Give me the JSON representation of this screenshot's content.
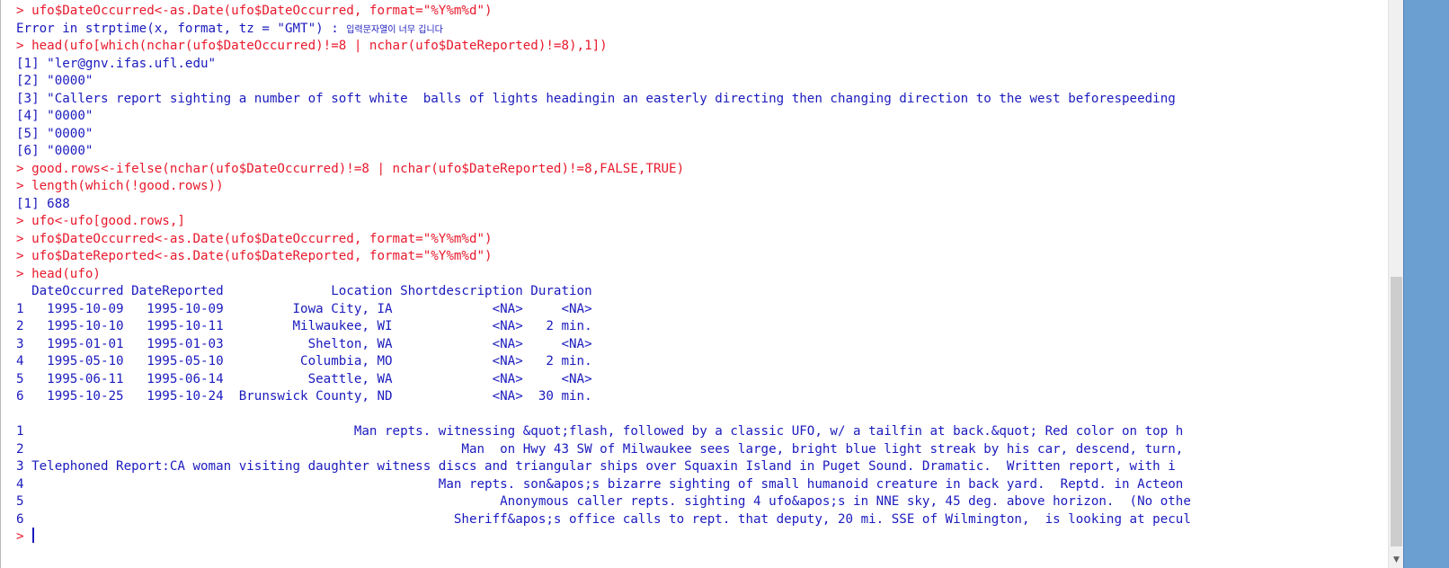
{
  "console": {
    "lines": [
      {
        "type": "cmd",
        "text": "> ufo$DateOccurred<-as.Date(ufo$DateOccurred, format=\"%Y%m%d\")"
      },
      {
        "type": "out",
        "text": "Error in strptime(x, format, tz = \"GMT\") : ",
        "kr": "입력문자열이 너무 깁니다"
      },
      {
        "type": "cmd",
        "text": "> head(ufo[which(nchar(ufo$DateOccurred)!=8 | nchar(ufo$DateReported)!=8),1])"
      },
      {
        "type": "out",
        "text": "[1] \"ler@gnv.ifas.ufl.edu\"",
        "end": "$"
      },
      {
        "type": "out",
        "text": "[2] \"0000\"",
        "end": "$"
      },
      {
        "type": "out",
        "text": "[3] \"Callers report sighting a number of soft white  balls of lights headingin an easterly directing then changing direction to the west beforespeeding",
        "end": "$"
      },
      {
        "type": "out",
        "text": "[4] \"0000\"",
        "end": "$"
      },
      {
        "type": "out",
        "text": "[5] \"0000\"",
        "end": "$"
      },
      {
        "type": "out",
        "text": "[6] \"0000\"",
        "end": "$"
      },
      {
        "type": "cmd",
        "text": "> good.rows<-ifelse(nchar(ufo$DateOccurred)!=8 | nchar(ufo$DateReported)!=8,FALSE,TRUE)"
      },
      {
        "type": "cmd",
        "text": "> length(which(!good.rows))"
      },
      {
        "type": "out",
        "text": "[1] 688"
      },
      {
        "type": "cmd",
        "text": "> ufo<-ufo[good.rows,]"
      },
      {
        "type": "cmd",
        "text": "> ufo$DateOccurred<-as.Date(ufo$DateOccurred, format=\"%Y%m%d\")"
      },
      {
        "type": "cmd",
        "text": "> ufo$DateReported<-as.Date(ufo$DateReported, format=\"%Y%m%d\")"
      },
      {
        "type": "cmd",
        "text": "> head(ufo)"
      },
      {
        "type": "out",
        "text": "  DateOccurred DateReported              Location Shortdescription Duration"
      },
      {
        "type": "out",
        "text": "1   1995-10-09   1995-10-09         Iowa City, IA             <NA>     <NA>"
      },
      {
        "type": "out",
        "text": "2   1995-10-10   1995-10-11         Milwaukee, WI             <NA>   2 min."
      },
      {
        "type": "out",
        "text": "3   1995-01-01   1995-01-03           Shelton, WA             <NA>     <NA>"
      },
      {
        "type": "out",
        "text": "4   1995-05-10   1995-05-10          Columbia, MO             <NA>   2 min."
      },
      {
        "type": "out",
        "text": "5   1995-06-11   1995-06-14           Seattle, WA             <NA>     <NA>"
      },
      {
        "type": "out",
        "text": "6   1995-10-25   1995-10-24  Brunswick County, ND             <NA>  30 min."
      },
      {
        "type": "out",
        "text": "",
        "end": "$"
      },
      {
        "type": "out",
        "text": "1                                           Man repts. witnessing &quot;flash, followed by a classic UFO, w/ a tailfin at back.&quot; Red color on top h",
        "end": "$"
      },
      {
        "type": "out",
        "text": "2                                                         Man  on Hwy 43 SW of Milwaukee sees large, bright blue light streak by his car, descend, turn, ",
        "end": "$"
      },
      {
        "type": "out",
        "text": "3 Telephoned Report:CA woman visiting daughter witness discs and triangular ships over Squaxin Island in Puget Sound. Dramatic.  Written report, with i",
        "end": "$"
      },
      {
        "type": "out",
        "text": "4                                                      Man repts. son&apos;s bizarre sighting of small humanoid creature in back yard.  Reptd. in Acteon ",
        "end": "$"
      },
      {
        "type": "out",
        "text": "5                                                              Anonymous caller repts. sighting 4 ufo&apos;s in NNE sky, 45 deg. above horizon.  (No othe",
        "end": "$"
      },
      {
        "type": "out",
        "text": "6                                                        Sheriff&apos;s office calls to rept. that deputy, 20 mi. SSE of Wilmington,  is looking at pecul",
        "end": "$"
      }
    ],
    "prompt": "> "
  },
  "scrollbar": {
    "down_arrow": "▼"
  }
}
